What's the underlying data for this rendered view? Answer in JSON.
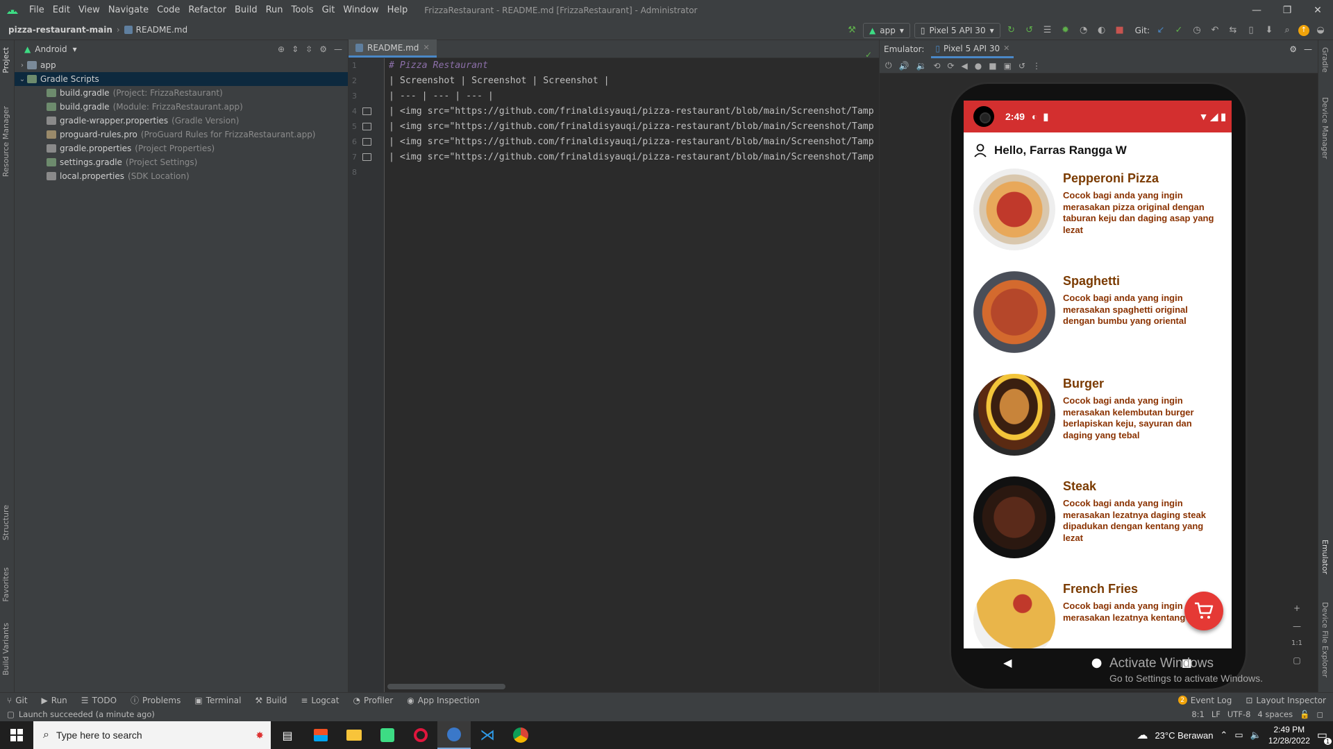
{
  "menubar": {
    "items": [
      "File",
      "Edit",
      "View",
      "Navigate",
      "Code",
      "Refactor",
      "Build",
      "Run",
      "Tools",
      "Git",
      "Window",
      "Help"
    ],
    "title": "FrizzaRestaurant - README.md [FrizzaRestaurant] - Administrator"
  },
  "navbar": {
    "project": "pizza-restaurant-main",
    "file": "README.md",
    "run_config": "app",
    "device": "Pixel 5 API 30",
    "git_label": "Git:"
  },
  "left_strip": {
    "project": "Project",
    "resource_manager": "Resource Manager",
    "structure": "Structure",
    "favorites": "Favorites",
    "build_variants": "Build Variants"
  },
  "right_strip": {
    "gradle": "Gradle",
    "device_manager": "Device Manager",
    "emulator": "Emulator",
    "device_file_explorer": "Device File Explorer"
  },
  "project_panel": {
    "view": "Android",
    "tree": [
      {
        "label": "app",
        "hint": "",
        "level": 0,
        "twisty": "›",
        "kind": "folder"
      },
      {
        "label": "Gradle Scripts",
        "hint": "",
        "level": 0,
        "twisty": "⌄",
        "kind": "gradle",
        "selected": true
      },
      {
        "label": "build.gradle",
        "hint": "(Project: FrizzaRestaurant)",
        "level": 1,
        "twisty": "",
        "kind": "gradle"
      },
      {
        "label": "build.gradle",
        "hint": "(Module: FrizzaRestaurant.app)",
        "level": 1,
        "twisty": "",
        "kind": "gradle"
      },
      {
        "label": "gradle-wrapper.properties",
        "hint": "(Gradle Version)",
        "level": 1,
        "twisty": "",
        "kind": "props"
      },
      {
        "label": "proguard-rules.pro",
        "hint": "(ProGuard Rules for FrizzaRestaurant.app)",
        "level": 1,
        "twisty": "",
        "kind": "file"
      },
      {
        "label": "gradle.properties",
        "hint": "(Project Properties)",
        "level": 1,
        "twisty": "",
        "kind": "props"
      },
      {
        "label": "settings.gradle",
        "hint": "(Project Settings)",
        "level": 1,
        "twisty": "",
        "kind": "gradle"
      },
      {
        "label": "local.properties",
        "hint": "(SDK Location)",
        "level": 1,
        "twisty": "",
        "kind": "props"
      }
    ]
  },
  "editor": {
    "tab": "README.md",
    "line_numbers": [
      "1",
      "2",
      "3",
      "4",
      "5",
      "6",
      "7",
      "8"
    ],
    "lines": [
      "# Pizza Restaurant",
      "| Screenshot | Screenshot | Screenshot |",
      "| --- | --- | --- |",
      "| <img src=\"https://github.com/frinaldisyauqi/pizza-restaurant/blob/main/Screenshot/Tamp:",
      "| <img src=\"https://github.com/frinaldisyauqi/pizza-restaurant/blob/main/Screenshot/Tamp:",
      "| <img src=\"https://github.com/frinaldisyauqi/pizza-restaurant/blob/main/Screenshot/Tamp:",
      "| <img src=\"https://github.com/frinaldisyauqi/pizza-restaurant/blob/main/Screenshot/Tamp:",
      ""
    ]
  },
  "emulator": {
    "label": "Emulator:",
    "tab": "Pixel 5 API 30",
    "status_time": "2:49",
    "greeting": "Hello, Farras Rangga W",
    "menu": [
      {
        "name": "Pepperoni Pizza",
        "desc": "Cocok bagi anda yang ingin merasakan pizza original dengan taburan keju dan daging asap yang lezat"
      },
      {
        "name": "Spaghetti",
        "desc": "Cocok bagi anda yang ingin merasakan spaghetti original dengan bumbu yang oriental"
      },
      {
        "name": "Burger",
        "desc": "Cocok bagi anda yang ingin merasakan kelembutan burger berlapiskan keju, sayuran dan daging yang tebal"
      },
      {
        "name": "Steak",
        "desc": "Cocok bagi anda yang ingin merasakan lezatnya daging steak dipadukan dengan kentang yang lezat"
      },
      {
        "name": "French Fries",
        "desc": "Cocok bagi anda yang ingin merasakan lezatnya kentang yang"
      }
    ],
    "zoom_ratio": "1:1"
  },
  "watermark": {
    "line1": "Activate Windows",
    "line2": "Go to Settings to activate Windows."
  },
  "bottom_tools": {
    "left": [
      "Git",
      "Run",
      "TODO",
      "Problems",
      "Terminal",
      "Build",
      "Logcat",
      "Profiler",
      "App Inspection"
    ],
    "right": [
      "Event Log",
      "Layout Inspector"
    ]
  },
  "statusbar": {
    "message": "Launch succeeded (a minute ago)",
    "position": "8:1",
    "line_sep": "LF",
    "encoding": "UTF-8",
    "indent": "4 spaces"
  },
  "taskbar": {
    "search_placeholder": "Type here to search",
    "weather": "23°C  Berawan",
    "time": "2:49 PM",
    "date": "12/28/2022",
    "notifications": "1"
  },
  "colors": {
    "ide_bg": "#2b2b2b",
    "panel_bg": "#3c3f41",
    "status_red": "#d32f2f",
    "food_title": "#7a3a00",
    "fab_red": "#e53935"
  }
}
